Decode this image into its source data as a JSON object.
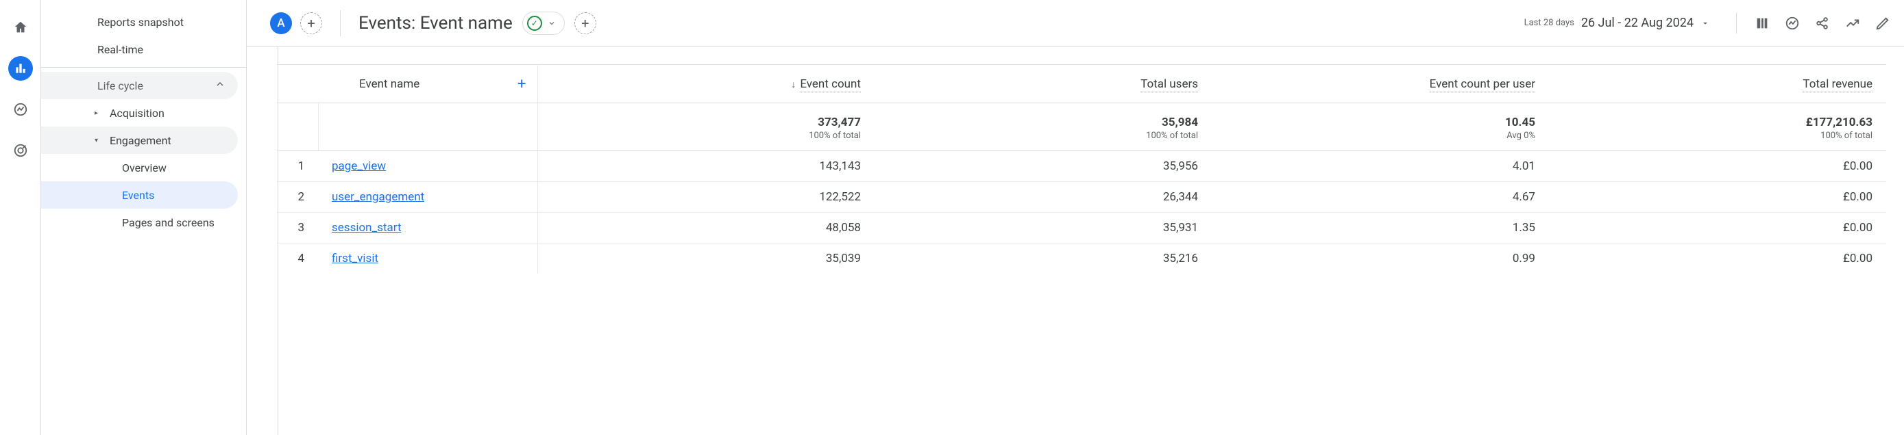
{
  "rail": {
    "home_icon": "home",
    "reports_icon": "bar-chart",
    "explore_icon": "line-chart",
    "ads_icon": "target"
  },
  "sidebar": {
    "items": [
      {
        "label": "Reports snapshot",
        "type": "top"
      },
      {
        "label": "Real-time",
        "type": "top"
      }
    ],
    "section": {
      "label": "Life cycle"
    },
    "acquisition": {
      "label": "Acquisition"
    },
    "engagement": {
      "label": "Engagement",
      "children": [
        {
          "label": "Overview"
        },
        {
          "label": "Events",
          "active": true
        },
        {
          "label": "Pages and screens"
        }
      ]
    }
  },
  "toolbar": {
    "badge": "A",
    "title": "Events: Event name",
    "date_label": "Last 28 days",
    "date_range": "26 Jul - 22 Aug 2024"
  },
  "table": {
    "headers": {
      "name": "Event name",
      "event_count": "Event count",
      "total_users": "Total users",
      "per_user": "Event count per user",
      "revenue": "Total revenue"
    },
    "totals": {
      "event_count": "373,477",
      "event_count_sub": "100% of total",
      "total_users": "35,984",
      "total_users_sub": "100% of total",
      "per_user": "10.45",
      "per_user_sub": "Avg 0%",
      "revenue": "£177,210.63",
      "revenue_sub": "100% of total"
    },
    "rows": [
      {
        "idx": "1",
        "name": "page_view",
        "event_count": "143,143",
        "total_users": "35,956",
        "per_user": "4.01",
        "revenue": "£0.00"
      },
      {
        "idx": "2",
        "name": "user_engagement",
        "event_count": "122,522",
        "total_users": "26,344",
        "per_user": "4.67",
        "revenue": "£0.00"
      },
      {
        "idx": "3",
        "name": "session_start",
        "event_count": "48,058",
        "total_users": "35,931",
        "per_user": "1.35",
        "revenue": "£0.00"
      },
      {
        "idx": "4",
        "name": "first_visit",
        "event_count": "35,039",
        "total_users": "35,216",
        "per_user": "0.99",
        "revenue": "£0.00"
      }
    ]
  }
}
